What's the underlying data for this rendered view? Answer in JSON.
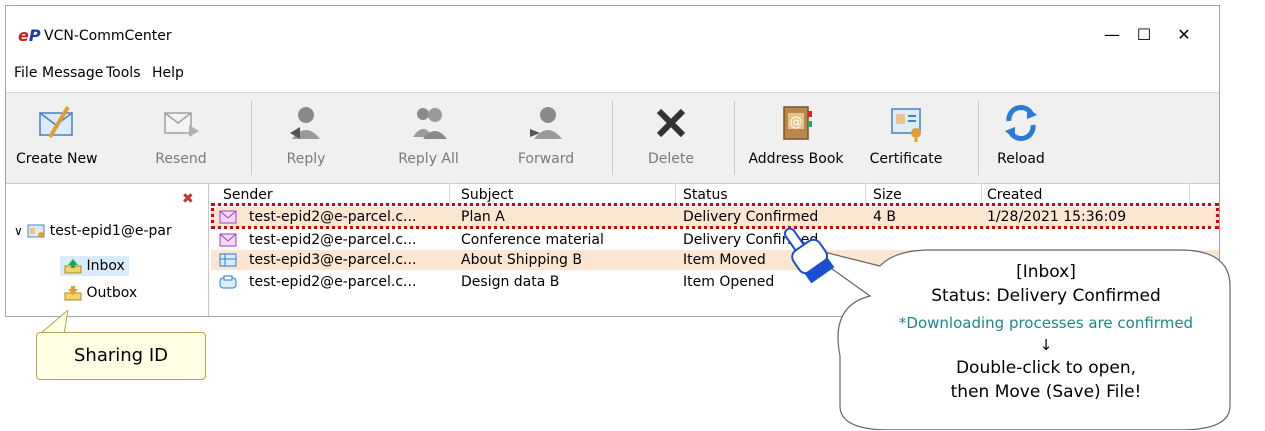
{
  "window": {
    "logo_e": "e",
    "logo_p": "P",
    "title": "VCN-CommCenter",
    "minimize": "—",
    "maximize": "☐",
    "close": "✕"
  },
  "menu": [
    "File",
    "Message",
    "Tools",
    "Help"
  ],
  "toolbar": {
    "create_new": "Create New",
    "resend": "Resend",
    "reply": "Reply",
    "reply_all": "Reply All",
    "forward": "Forward",
    "delete": "Delete",
    "address_book": "Address Book",
    "certificate": "Certificate",
    "reload": "Reload"
  },
  "tree": {
    "close_glyph": "✖",
    "expand_glyph": "∨",
    "account": "test-epid1@e-par",
    "inbox": "Inbox",
    "outbox": "Outbox"
  },
  "columns": {
    "sender": "Sender",
    "subject": "Subject",
    "status": "Status",
    "size": "Size",
    "created": "Created"
  },
  "rows": [
    {
      "sender": "test-epid2@e-parcel.c...",
      "subject": "Plan A",
      "status": "Delivery Confirmed",
      "size": "4 B",
      "created": "1/28/2021 15:36:09"
    },
    {
      "sender": "test-epid2@e-parcel.c...",
      "subject": "Conference material",
      "status": "Delivery Confirmed",
      "size": "",
      "created": ""
    },
    {
      "sender": "test-epid3@e-parcel.c...",
      "subject": "About Shipping B",
      "status": "Item Moved",
      "size": "",
      "created": ""
    },
    {
      "sender": "test-epid2@e-parcel.c...",
      "subject": "Design data B",
      "status": "Item Opened",
      "size": "",
      "created": ""
    }
  ],
  "callout_sharing": "Sharing ID",
  "bubble": {
    "line1": "[Inbox]",
    "line2": "Status: Delivery Confirmed",
    "line3": "*Downloading processes are confirmed",
    "arrow": "↓",
    "line4": "Double-click to open,",
    "line5": "then Move (Save) File!"
  },
  "colors": {
    "highlight_row": "#fbe6d2",
    "dashed_border": "#e00000",
    "note_text": "#1a8a8a",
    "callout_fill": "#ffffe6",
    "selected_node": "#d9ecfb"
  }
}
